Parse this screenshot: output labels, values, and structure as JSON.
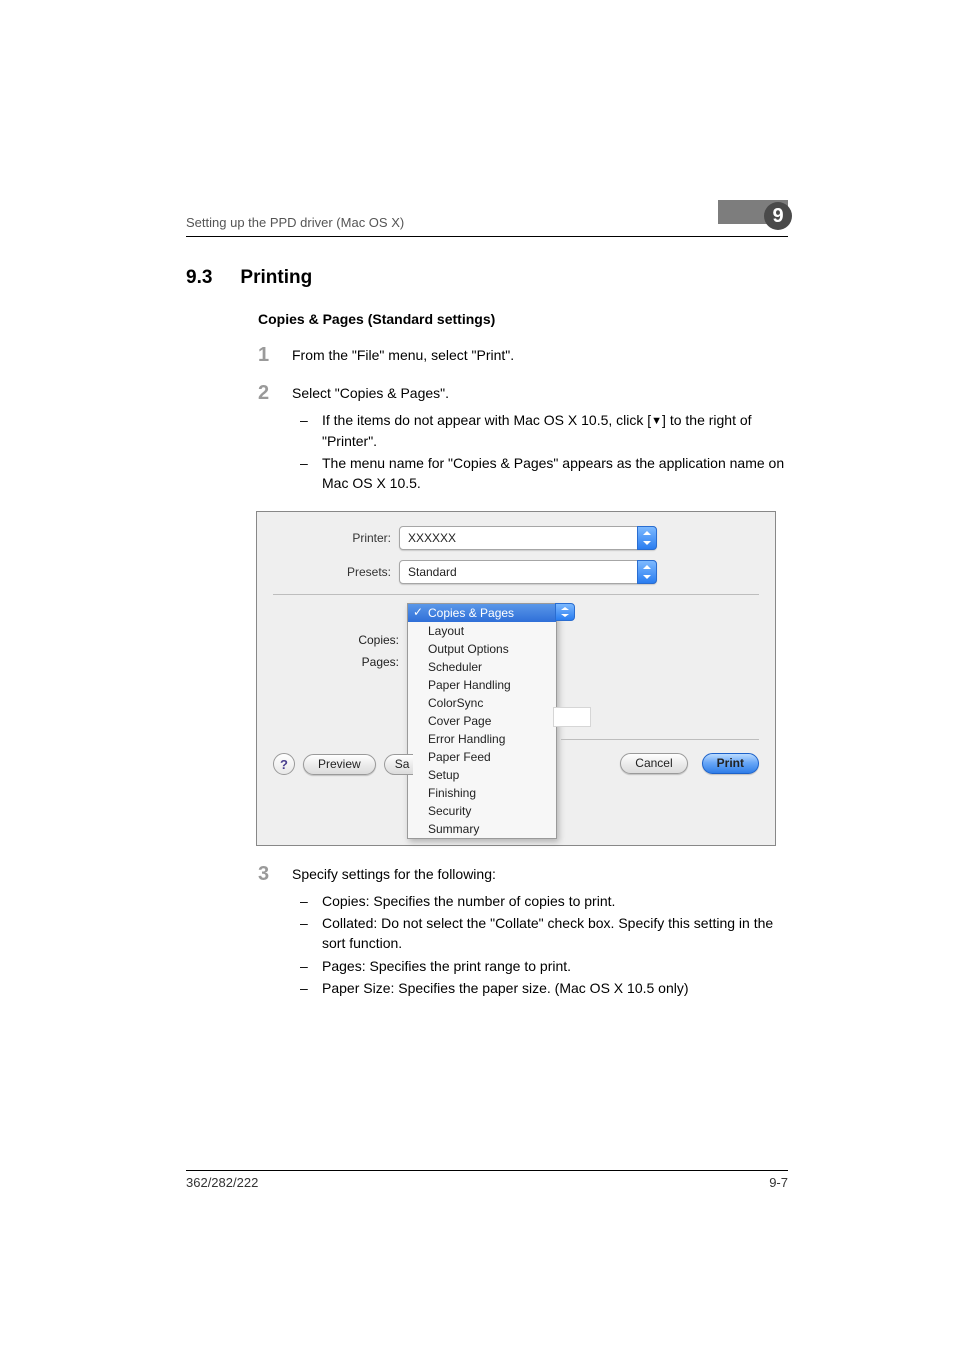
{
  "running_header": {
    "text": "Setting up the PPD driver (Mac OS X)",
    "chapter_number": "9"
  },
  "section": {
    "number": "9.3",
    "title": "Printing"
  },
  "subsection_title": "Copies & Pages (Standard settings)",
  "steps": {
    "s1": {
      "num": "1",
      "text": "From the \"File\" menu, select \"Print\"."
    },
    "s2": {
      "num": "2",
      "text": "Select \"Copies & Pages\".",
      "sub1_a": "If the items do not appear with Mac OS X 10.5, click [",
      "sub1_b": "] to the right of \"Printer\".",
      "sub2": "The menu name for \"Copies & Pages\" appears as the application name on Mac OS X 10.5."
    },
    "s3": {
      "num": "3",
      "text": "Specify settings for the following:",
      "sub1": "Copies: Specifies the number of copies to print.",
      "sub2": "Collated: Do not select the \"Collate\" check box. Specify this setting in the sort function.",
      "sub3": "Pages: Specifies the print range to print.",
      "sub4": "Paper Size: Specifies the paper size. (Mac OS X 10.5 only)"
    }
  },
  "dialog": {
    "printer_label": "Printer:",
    "printer_value": "XXXXXX",
    "presets_label": "Presets:",
    "presets_value": "Standard",
    "copies_label": "Copies:",
    "pages_label": "Pages:",
    "menu": {
      "selected": "Copies & Pages",
      "items": [
        "Layout",
        "Output Options",
        "Scheduler",
        "Paper Handling",
        "ColorSync",
        "Cover Page",
        "Error Handling",
        "Paper Feed",
        "Setup",
        "Finishing",
        "Security",
        "Summary"
      ]
    },
    "help_glyph": "?",
    "preview_label": "Preview",
    "save_fragment": "Sa",
    "cancel_label": "Cancel",
    "print_label": "Print"
  },
  "footer": {
    "left": "362/282/222",
    "right": "9-7"
  },
  "glyphs": {
    "down_triangle": "▼"
  }
}
